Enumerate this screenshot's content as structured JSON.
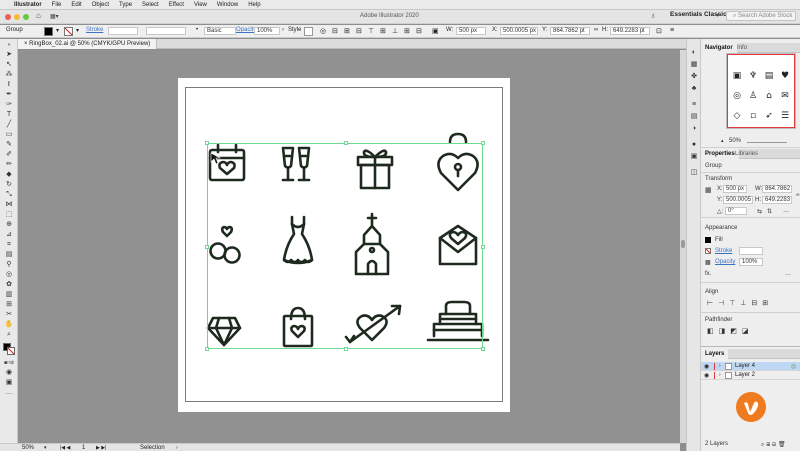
{
  "menubar": {
    "app": "Illustrator",
    "items": [
      "File",
      "Edit",
      "Object",
      "Type",
      "Select",
      "Effect",
      "View",
      "Window",
      "Help"
    ]
  },
  "appbar": {
    "title": "Adobe Illustrator 2020",
    "workspace": "Essentials Classic",
    "search_placeholder": "Search Adobe Stock"
  },
  "controlbar": {
    "selection_type": "Group",
    "stroke_label": "Stroke",
    "brush": "Basic",
    "opacity_label": "Opacity",
    "opacity_value": "100%",
    "style_label": "Style",
    "w_label": "W:",
    "w_value": "500 px",
    "x_label": "X:",
    "x_value": "500.0005 px",
    "y_label": "Y:",
    "y_value": "864.7862 pt",
    "h_label": "H:",
    "h_value": "649.2283 pt"
  },
  "document_tab": {
    "label": "RingBox_02.ai @ 50% (CMYK/GPU Preview)"
  },
  "statusbar": {
    "zoom": "50%",
    "artboard": "1",
    "tool": "Selection"
  },
  "panels": {
    "navigator_tabs": [
      "Navigator",
      "Info"
    ],
    "navigator_zoom": "50%",
    "properties_tabs": [
      "Properties",
      "Libraries"
    ],
    "group_label": "Group",
    "transform_label": "Transform",
    "transform": {
      "x_label": "X:",
      "x": "500 px",
      "w_label": "W:",
      "w": "864.7862",
      "y_label": "Y:",
      "y": "500.0005",
      "h_label": "H:",
      "h": "649.2283",
      "angle_label": "△:",
      "angle": "0°"
    },
    "appearance_label": "Appearance",
    "fill_label": "Fill",
    "stroke_label": "Stroke",
    "opacity_label": "Opacity",
    "opacity_value": "100%",
    "fx_label": "fx.",
    "align_label": "Align",
    "pathfinder_label": "Pathfinder",
    "layers_tab": "Layers",
    "layers": [
      {
        "name": "Layer 4",
        "selected": true
      },
      {
        "name": "Layer 2",
        "selected": false
      }
    ],
    "layers_count": "2 Layers"
  },
  "icons": [
    "calendar-heart-icon",
    "champagne-glasses-icon",
    "gift-box-icon",
    "heart-lock-icon",
    "wedding-rings-icon",
    "wedding-dress-icon",
    "chapel-icon",
    "love-letter-icon",
    "diamond-icon",
    "heart-shopping-bag-icon",
    "arrow-heart-icon",
    "wedding-cake-icon"
  ],
  "colors": {
    "selection_green": "#6fd891",
    "icon_stroke": "#1e2a1e",
    "watermark_orange": "#f07a1e"
  }
}
